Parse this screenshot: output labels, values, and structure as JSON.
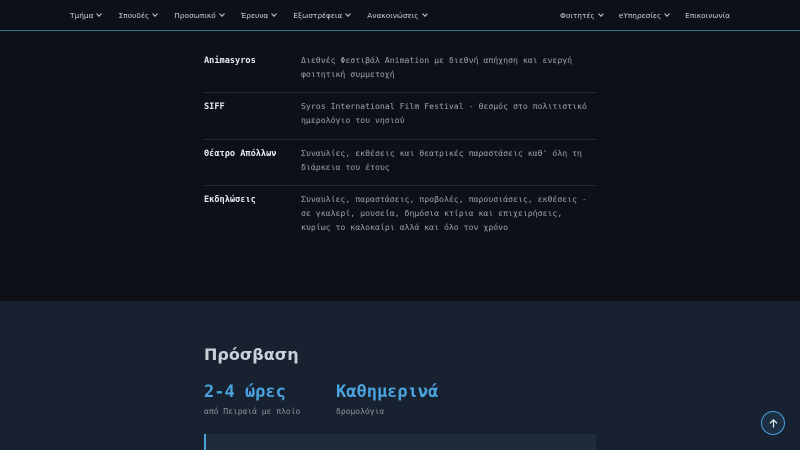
{
  "nav": {
    "left": [
      {
        "label": "Τμήμα",
        "icon": "chevron-down-icon"
      },
      {
        "label": "Σπουδές",
        "icon": "chevron-down-icon"
      },
      {
        "label": "Προσωπικό",
        "icon": "chevron-down-icon"
      },
      {
        "label": "Έρευνα",
        "icon": "chevron-down-icon"
      },
      {
        "label": "Εξωστρέφεια",
        "icon": "chevron-down-icon"
      },
      {
        "label": "Ανακοινώσεις",
        "icon": "chevron-down-icon"
      }
    ],
    "right": [
      {
        "label": "Φοιτητές",
        "icon": "chevron-down-icon"
      },
      {
        "label": "eΥπηρεσίες",
        "icon": "chevron-down-icon"
      },
      {
        "label": "Επικοινωνία"
      }
    ]
  },
  "features": [
    {
      "name": "Animasyros",
      "desc": "Διεθνές Φεστιβάλ Animation με διεθνή απήχηση και ενεργή φοιτητική συμμετοχή"
    },
    {
      "name": "SIFF",
      "desc": "Syros International Film Festival - θεσμός στο πολιτιστικό ημερολόγιο του νησιού"
    },
    {
      "name": "Θέατρο Απόλλων",
      "desc": "Συναυλίες, εκθέσεις και θεατρικές παραστάσεις καθ' όλη τη διάρκεια του έτους"
    },
    {
      "name": "Εκδηλώσεις",
      "desc": "Συναυλίες, παραστάσεις, προβολές, παρουσιάσεις, εκθέσεις - σε γκαλερί, μουσεία, δημόσια κτίρια και επιχειρήσεις, κυρίως το καλοκαίρι αλλά και όλο τον χρόνο"
    }
  ],
  "access": {
    "title": "Πρόσβαση",
    "stats": [
      {
        "value": "2-4 ώρες",
        "label": "από Πειραιά με πλοίο"
      },
      {
        "value": "Καθημερινά",
        "label": "δρομολόγια"
      }
    ]
  },
  "colors": {
    "accent": "#4aa3df",
    "background": "#0d1117",
    "section": "#182130"
  },
  "scroll_top": {
    "icon": "arrow-up-icon"
  }
}
